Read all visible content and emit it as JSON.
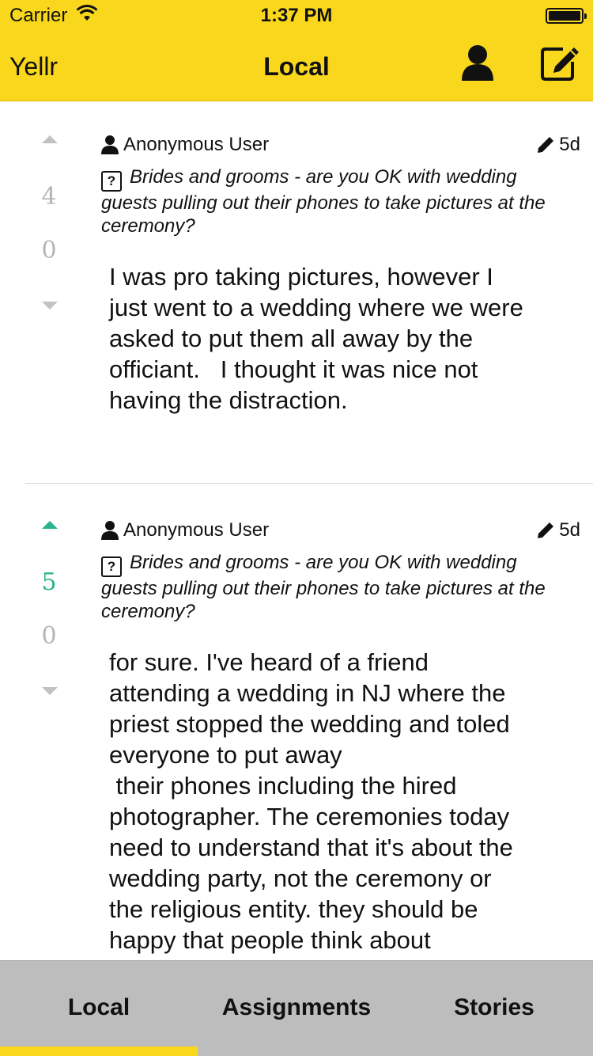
{
  "status_bar": {
    "carrier": "Carrier",
    "time": "1:37 PM"
  },
  "nav": {
    "brand": "Yellr",
    "title": "Local",
    "profile_icon": "person-icon",
    "compose_icon": "compose-icon"
  },
  "colors": {
    "accent": "#f9d71c",
    "upvoted": "#2bb38f",
    "vote_inactive": "#b5b5b5",
    "tabbar": "#bdbdbd"
  },
  "posts": [
    {
      "author": "Anonymous User",
      "age": "5d",
      "question": "Brides and grooms - are you OK with wedding guests pulling out their phones to take pictures at the ceremony?",
      "upvotes": "4",
      "downvotes": "0",
      "upvoted": false,
      "body": "I was pro taking pictures, however I\njust went to a wedding where we were\nasked to put them all away by the\nofficiant.   I thought it was nice not\nhaving the distraction."
    },
    {
      "author": "Anonymous User",
      "age": "5d",
      "question": "Brides and grooms - are you OK with wedding guests pulling out their phones to take pictures at the ceremony?",
      "upvotes": "5",
      "downvotes": "0",
      "upvoted": true,
      "body": "for sure. I've heard of a friend\nattending a wedding in NJ where the\npriest stopped the wedding and toled\neveryone to put away\n their phones including the hired\nphotographer. The ceremonies today\nneed to understand that it's about the\nwedding party, not the ceremony or\nthe religious entity. they should be\nhappy that people think about\nbeing there to capture this special"
    }
  ],
  "tabs": [
    {
      "label": "Local",
      "active": true
    },
    {
      "label": "Assignments",
      "active": false
    },
    {
      "label": "Stories",
      "active": false
    }
  ]
}
